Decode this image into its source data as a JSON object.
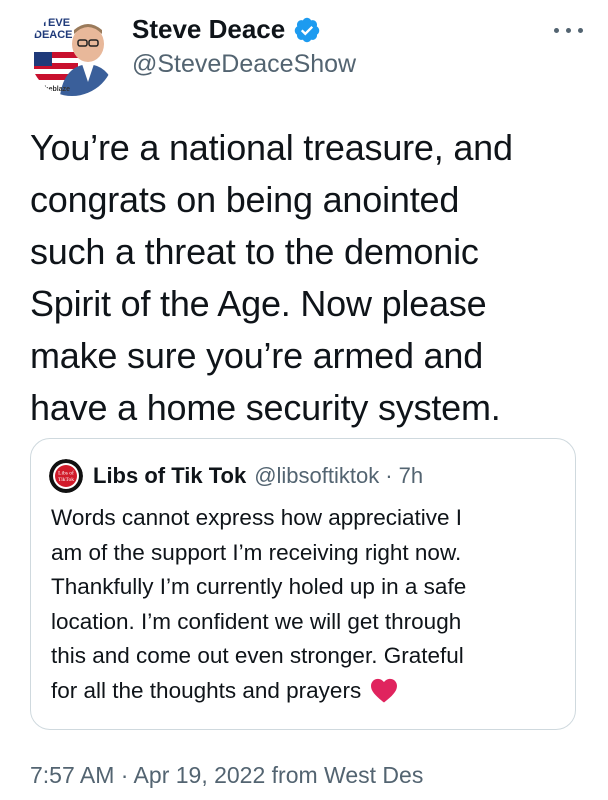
{
  "author": {
    "name": "Steve Deace",
    "handle": "@SteveDeaceShow",
    "avatar_logo_text": "STEVE DEACE",
    "avatar_brand_text": "theblaze",
    "verified": true
  },
  "tweet": {
    "lines": [
      "You’re a national treasure, and",
      "congrats on being anointed",
      "such a threat to the demonic",
      "Spirit of the Age. Now please",
      "make sure you’re armed and",
      "have a home security system."
    ]
  },
  "quote": {
    "name": "Libs of Tik Tok",
    "handle": "@libsoftiktok",
    "separator": "·",
    "time": "7h",
    "avatar_text": "Libs of TikTok",
    "lines": [
      "Words cannot express how appreciative I",
      "am of the support I’m receiving right now.",
      "Thankfully I’m currently holed up in a safe",
      "location. I’m confident we will get through",
      "this and come out even stronger. Grateful",
      "for all the thoughts and prayers"
    ]
  },
  "footer": {
    "timestamp": "7:57 AM · Apr 19, 2022 from West Des"
  },
  "colors": {
    "text": "#0f1419",
    "secondary": "#536471",
    "verified": "#1d9bf0",
    "border": "#cfd9de",
    "heart": "#e0245e"
  }
}
